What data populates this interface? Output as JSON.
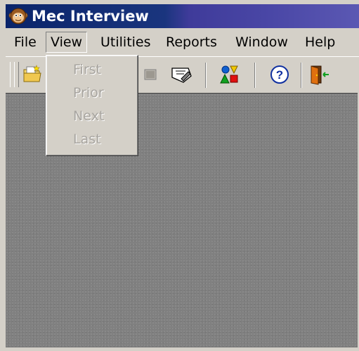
{
  "window": {
    "title": "Mec Interview"
  },
  "menubar": {
    "items": [
      {
        "label": "File"
      },
      {
        "label": "View"
      },
      {
        "label": "Utilities"
      },
      {
        "label": "Reports"
      },
      {
        "label": "Window"
      },
      {
        "label": "Help"
      }
    ],
    "active": "View"
  },
  "view_menu": {
    "items": [
      {
        "label": "First",
        "enabled": false
      },
      {
        "label": "Prior",
        "enabled": false
      },
      {
        "label": "Next",
        "enabled": false
      },
      {
        "label": "Last",
        "enabled": false
      }
    ]
  },
  "toolbar": {
    "buttons": [
      {
        "icon": "open-folder-icon"
      },
      {
        "icon": "record-icon"
      },
      {
        "icon": "edit-card-icon"
      },
      {
        "icon": "shapes-icon"
      },
      {
        "icon": "help-icon"
      },
      {
        "icon": "exit-door-icon"
      }
    ]
  },
  "colors": {
    "titlebar_start": "#0a246a",
    "titlebar_end": "#5b58b3",
    "chrome": "#d4d0c8",
    "workspace": "#808080",
    "disabled_text": "#a8a5a0"
  }
}
